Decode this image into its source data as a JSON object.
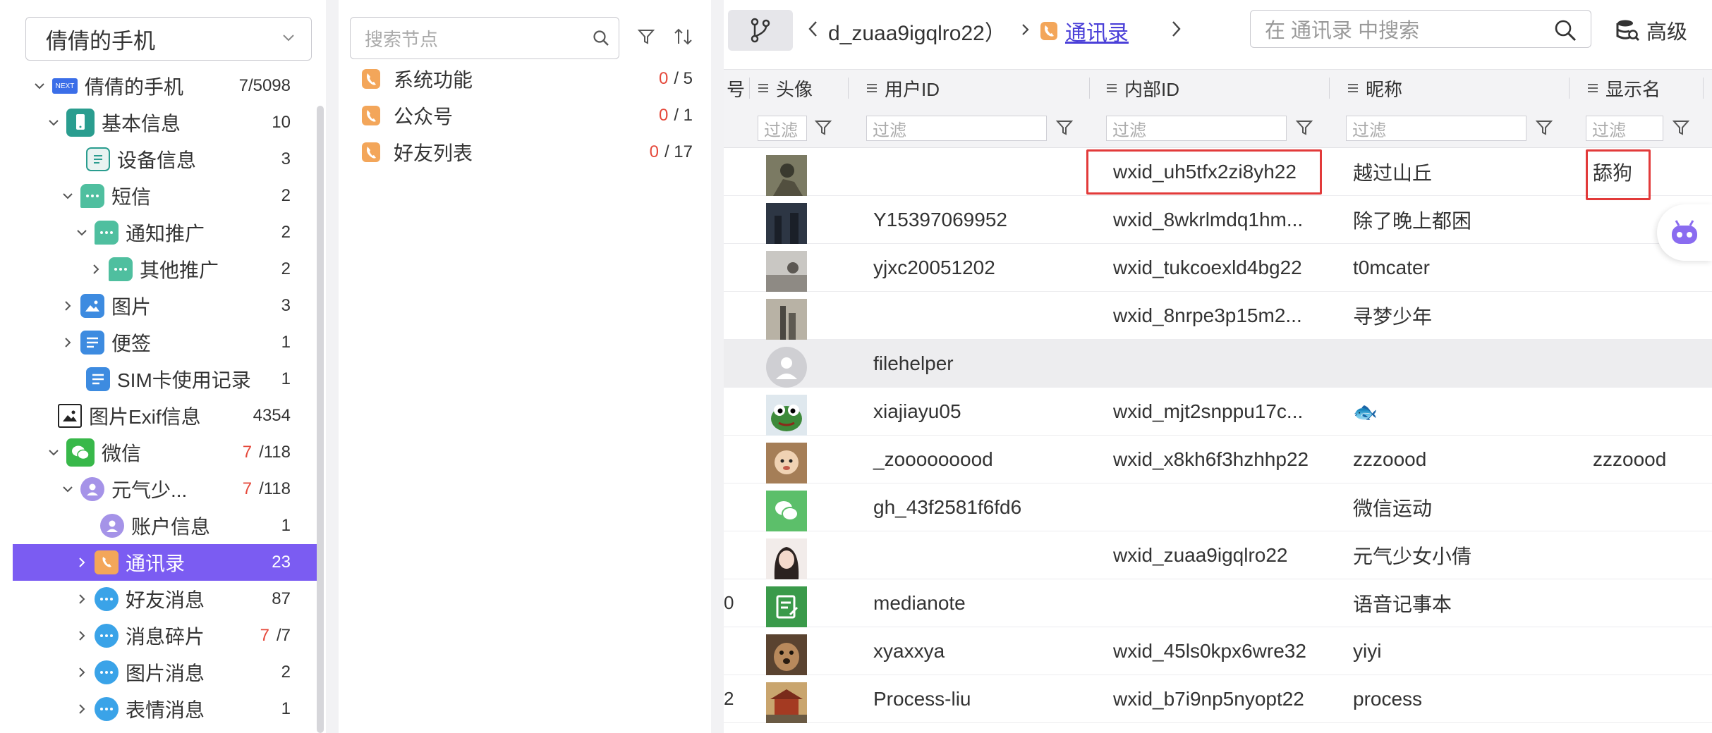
{
  "device_select": {
    "value": "倩倩的手机"
  },
  "tree": {
    "items": [
      {
        "label": "倩倩的手机",
        "count": "7/5098",
        "red": "",
        "level": 0,
        "icon": "next-icon",
        "twisty": "open"
      },
      {
        "label": "基本信息",
        "count": "10",
        "red": "",
        "level": 1,
        "icon": "phone-info-icon",
        "twisty": "open"
      },
      {
        "label": "设备信息",
        "count": "3",
        "red": "",
        "level": 2,
        "icon": "device-doc-icon",
        "twisty": "none"
      },
      {
        "label": "短信",
        "count": "2",
        "red": "",
        "level": 2,
        "icon": "sms-icon",
        "twisty": "open"
      },
      {
        "label": "通知推广",
        "count": "2",
        "red": "",
        "level": 3,
        "icon": "sms-icon",
        "twisty": "open"
      },
      {
        "label": "其他推广",
        "count": "2",
        "red": "",
        "level": 4,
        "icon": "sms-icon",
        "twisty": "closed"
      },
      {
        "label": "图片",
        "count": "3",
        "red": "",
        "level": 2,
        "icon": "picture-icon",
        "twisty": "closed"
      },
      {
        "label": "便签",
        "count": "1",
        "red": "",
        "level": 2,
        "icon": "note-icon",
        "twisty": "closed"
      },
      {
        "label": "SIM卡使用记录",
        "count": "1",
        "red": "",
        "level": 2,
        "icon": "sim-list-icon",
        "twisty": "none"
      },
      {
        "label": "图片Exif信息",
        "count": "4354",
        "red": "",
        "level": 1,
        "icon": "image-exif-icon",
        "twisty": "none"
      },
      {
        "label": "微信",
        "count": "/118",
        "red": "7",
        "level": 1,
        "icon": "wechat-icon",
        "twisty": "open"
      },
      {
        "label": "元气少...",
        "count": "/118",
        "red": "7",
        "level": 2,
        "icon": "user-avatar-icon",
        "twisty": "open"
      },
      {
        "label": "账户信息",
        "count": "1",
        "red": "",
        "level": 3,
        "icon": "user-avatar-icon",
        "twisty": "none"
      },
      {
        "label": "通讯录",
        "count": "23",
        "red": "",
        "level": 3,
        "icon": "contacts-icon",
        "twisty": "closed"
      },
      {
        "label": "好友消息",
        "count": "87",
        "red": "",
        "level": 3,
        "icon": "chat-bubble-icon",
        "twisty": "closed"
      },
      {
        "label": "消息碎片",
        "count": "/7",
        "red": "7",
        "level": 3,
        "icon": "chat-bubble-icon",
        "twisty": "closed"
      },
      {
        "label": "图片消息",
        "count": "2",
        "red": "",
        "level": 3,
        "icon": "chat-bubble-icon",
        "twisty": "closed"
      },
      {
        "label": "表情消息",
        "count": "1",
        "red": "",
        "level": 3,
        "icon": "chat-bubble-icon",
        "twisty": "closed"
      }
    ],
    "selected_label": "通讯录"
  },
  "node_panel": {
    "search_placeholder": "搜索节点",
    "nodes": [
      {
        "label": "系统功能",
        "red": "0",
        "total": "/ 5"
      },
      {
        "label": "公众号",
        "red": "0",
        "total": "/ 1"
      },
      {
        "label": "好友列表",
        "red": "0",
        "total": "/ 17"
      }
    ]
  },
  "toolbar": {
    "breadcrumb_prev": "d_zuaa9igqlro22）",
    "breadcrumb_current": "通讯录",
    "search_placeholder": "在 通讯录 中搜索",
    "advanced_label": "高级"
  },
  "table": {
    "columns": [
      "号",
      "头像",
      "用户ID",
      "内部ID",
      "昵称",
      "显示名"
    ],
    "filter_placeholder": "过滤",
    "rows": [
      {
        "edge": "",
        "avatar": "photo-avatar-1",
        "user_id": "",
        "internal_id": "wxid_uh5tfx2zi8yh22",
        "nickname": "越过山丘",
        "display": "舔狗"
      },
      {
        "edge": "",
        "avatar": "photo-avatar-2",
        "user_id": "Y15397069952",
        "internal_id": "wxid_8wkrlmdq1hm...",
        "nickname": "除了晚上都困",
        "display": ""
      },
      {
        "edge": "",
        "avatar": "photo-avatar-3",
        "user_id": "yjxc20051202",
        "internal_id": "wxid_tukcoexld4bg22",
        "nickname": "t0mcater",
        "display": ""
      },
      {
        "edge": "",
        "avatar": "photo-avatar-4",
        "user_id": "",
        "internal_id": "wxid_8nrpe3p15m2...",
        "nickname": "寻梦少年",
        "display": ""
      },
      {
        "edge": "",
        "avatar": "default-avatar",
        "user_id": "filehelper",
        "internal_id": "",
        "nickname": "",
        "display": ""
      },
      {
        "edge": "",
        "avatar": "frog-avatar",
        "user_id": "xiajiayu05",
        "internal_id": "wxid_mjt2snppu17c...",
        "nickname": "🐟",
        "display": ""
      },
      {
        "edge": "",
        "avatar": "baby-avatar",
        "user_id": "_zooooooood",
        "internal_id": "wxid_x8kh6f3hzhhp22",
        "nickname": "zzzoood",
        "display": "zzzoood"
      },
      {
        "edge": "",
        "avatar": "wechat-sport-avatar",
        "user_id": "gh_43f2581f6fd6",
        "internal_id": "",
        "nickname": "微信运动",
        "display": ""
      },
      {
        "edge": "",
        "avatar": "girl-avatar",
        "user_id": "",
        "internal_id": "wxid_zuaa9igqlro22",
        "nickname": "元气少女小倩",
        "display": ""
      },
      {
        "edge": "0",
        "avatar": "medianote-avatar",
        "user_id": "medianote",
        "internal_id": "",
        "nickname": "语音记事本",
        "display": ""
      },
      {
        "edge": "",
        "avatar": "dog-avatar",
        "user_id": "xyaxxya",
        "internal_id": "wxid_45ls0kpx6wre32",
        "nickname": "yiyi",
        "display": ""
      },
      {
        "edge": "2",
        "avatar": "temple-avatar",
        "user_id": "Process-liu",
        "internal_id": "wxid_b7i9np5nyopt22",
        "nickname": "process",
        "display": ""
      }
    ]
  },
  "colors": {
    "accent": "#7b5cf2",
    "highlight_box": "#e23a3a",
    "count_red": "#e5483a",
    "link": "#4a3fd8"
  }
}
